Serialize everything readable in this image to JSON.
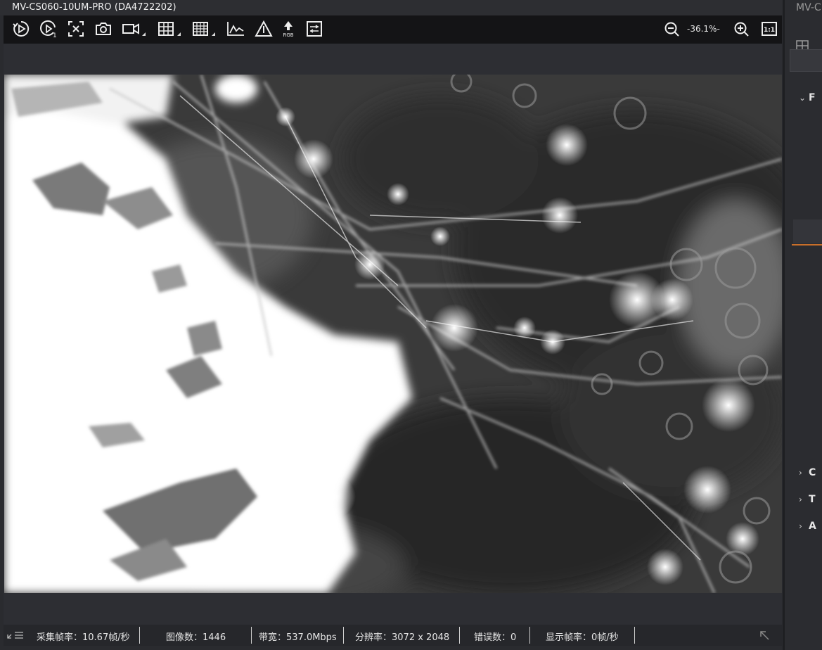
{
  "window": {
    "title": "MV-CS060-10UM-PRO (DA4722202)"
  },
  "toolbar": {
    "buttons": [
      {
        "name": "start-grab-icon"
      },
      {
        "name": "single-grab-icon"
      },
      {
        "name": "stop-grab-icon"
      },
      {
        "name": "snapshot-icon"
      },
      {
        "name": "record-icon",
        "dropdown": true
      },
      {
        "name": "crosshair-grid-icon",
        "dropdown": true
      },
      {
        "name": "grid-overlay-icon",
        "dropdown": true
      },
      {
        "name": "histogram-icon"
      },
      {
        "name": "warning-icon"
      },
      {
        "name": "rgb-icon",
        "caption": "RGB"
      },
      {
        "name": "adjust-icon"
      }
    ],
    "zoom_out_icon": "zoom-out-icon",
    "zoom_value": "-36.1%-",
    "zoom_in_icon": "zoom-in-icon",
    "actual_size_label": "1:1"
  },
  "status_bar": {
    "acq_fps": "采集帧率：10.67帧/秒",
    "image_count": "图像数：1446",
    "bandwidth": "带宽：537.0Mbps",
    "resolution": "分辨率：3072 x 2048",
    "error_count": "错误数：0",
    "display_fps": "显示帧率：0帧/秒"
  },
  "right_panel": {
    "title": "MV-C",
    "sections": [
      {
        "label": "F",
        "expanded": true
      },
      {
        "label": "C",
        "expanded": false
      },
      {
        "label": "T",
        "expanded": false
      },
      {
        "label": "A",
        "expanded": false
      }
    ],
    "accent_color": "#c86f2a"
  }
}
